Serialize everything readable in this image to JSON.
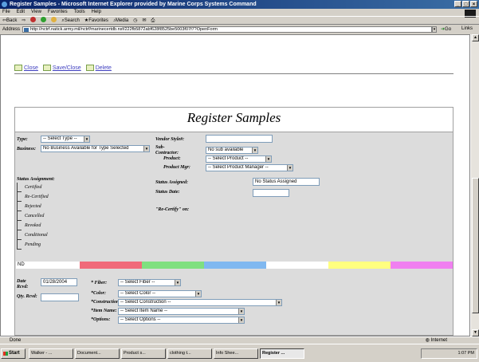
{
  "window": {
    "title": "Register Samples - Microsoft Internet Explorer provided by Marine Corps Systems Command"
  },
  "menu": [
    "File",
    "Edit",
    "View",
    "Favorites",
    "Tools",
    "Help"
  ],
  "toolbar": {
    "back": "Back",
    "search": "Search",
    "favorites": "Favorites",
    "media": "Media"
  },
  "address": {
    "label": "Address",
    "url": "http://nctrf.natick.army.mil/nctrf/marinecertdb.nsf/222fb5872abf628f8525be5003f07f7?OpenForm",
    "go": "Go",
    "links": "Links"
  },
  "actions": {
    "close": "Close",
    "save_close": "Save/Close",
    "delete": "Delete"
  },
  "form": {
    "title": "Register Samples",
    "type_label": "Type:",
    "type_value": "-- Select Type --",
    "business_label": "Business:",
    "business_value": "No Business Available for Type Selected",
    "vendor_style_label": "Vendor Style#:",
    "subcontractor_label": "Sub-Contractor:",
    "subcontractor_value": "No sub available",
    "product_label": "Product:",
    "product_value": "-- Select Product --",
    "product_mgr_label": "Product Mgr:",
    "product_mgr_value": "-- Select Product Manager --",
    "status_assignment_label": "Status Assignment:",
    "statuses": [
      "Certified",
      "Re-Certified",
      "Rejected",
      "Cancelled",
      "Revoked",
      "Conditional",
      "Pending"
    ],
    "status_assigned_label": "Status Assigned:",
    "status_assigned_value": "No Status Assigned",
    "status_date_label": "Status Date:",
    "recertify_label": "\"Re-Certify\" on:",
    "colorbar_code": "ND",
    "colorbar_colors": [
      "#ffffff",
      "#f06a7a",
      "#7fe07f",
      "#80b8f0",
      "#ffffff",
      "#ffff80",
      "#f080f0"
    ],
    "date_rcvd_label": "Date Rcvd:",
    "date_rcvd_value": "01/28/2004",
    "qty_rcvd_label": "Qty. Rcvd:",
    "fiber_label": "* Fiber:",
    "fiber_value": "-- Select Fiber --",
    "color_label": "*Color:",
    "color_value": "-- Select Color --",
    "construction_label": "*Construction:",
    "construction_value": "-- Select Construction --",
    "item_name_label": "*Item Name:",
    "item_name_value": "-- Select Item Name --",
    "options_label": "*Options:",
    "options_value": "-- Select Options --"
  },
  "statusbar": {
    "text": "Done",
    "zone": "Internet"
  },
  "taskbar": {
    "start": "Start",
    "tasks": [
      "Walker - ...",
      "Document...",
      "Product s...",
      "clothing t...",
      "Info Shee...",
      "Register ..."
    ],
    "clock": "1:07 PM"
  }
}
